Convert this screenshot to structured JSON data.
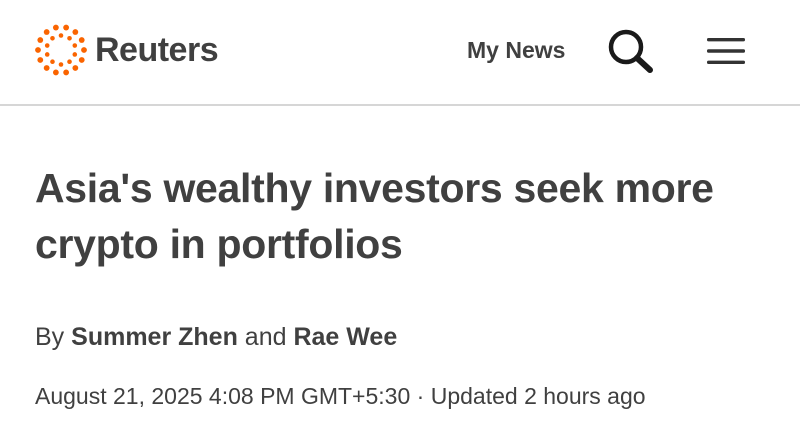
{
  "header": {
    "brand": "Reuters",
    "my_news_label": "My News",
    "search_icon": "search-icon",
    "menu_icon": "hamburger-menu-icon",
    "brand_color": "#fa6400",
    "divider_color": "#d6d6d6"
  },
  "article": {
    "headline": "Asia's wealthy investors seek more crypto in portfolios",
    "byline_prefix": "By",
    "author_1": "Summer Zhen",
    "byline_joiner": "and",
    "author_2": "Rae Wee",
    "published": "August 21, 2025 4:08 PM GMT+5:30",
    "separator": "·",
    "updated": "Updated 2 hours ago"
  }
}
